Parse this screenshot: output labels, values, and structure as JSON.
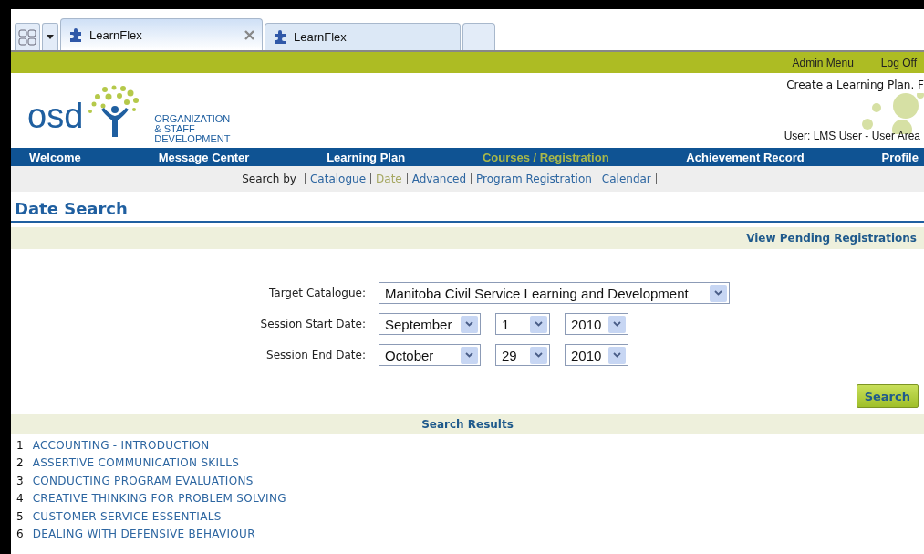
{
  "browser_tabs": [
    {
      "title": "LearnFlex",
      "selected": true
    },
    {
      "title": "LearnFlex",
      "selected": false
    }
  ],
  "top_links": [
    "Admin Menu",
    "Log Off"
  ],
  "logo": {
    "short": "osd",
    "line1": "ORGANIZATION",
    "line2": "& STAFF",
    "line3": "DEVELOPMENT"
  },
  "tagline": "Create a Learning Plan. F",
  "user_info": "User: LMS User - User Area",
  "nav": [
    {
      "label": "Welcome",
      "selected": false
    },
    {
      "label": "Message Center",
      "selected": false
    },
    {
      "label": "Learning Plan",
      "selected": false
    },
    {
      "label": "Courses / Registration",
      "selected": true
    },
    {
      "label": "Achievement Record",
      "selected": false
    },
    {
      "label": "Profile",
      "selected": false
    }
  ],
  "subnav": {
    "label": "Search by",
    "links": [
      {
        "label": "Catalogue",
        "selected": false
      },
      {
        "label": "Date",
        "selected": true
      },
      {
        "label": "Advanced",
        "selected": false
      },
      {
        "label": "Program Registration",
        "selected": false
      },
      {
        "label": "Calendar",
        "selected": false
      }
    ]
  },
  "page_title": "Date Search",
  "pending_link": "View Pending Registrations",
  "form": [
    {
      "label": "Target Catalogue:",
      "selects": [
        "Manitoba Civil Service Learning and Development"
      ]
    },
    {
      "label": "Session Start Date:",
      "selects": [
        "September",
        "1",
        "2010"
      ]
    },
    {
      "label": "Session End Date:",
      "selects": [
        "October",
        "29",
        "2010"
      ]
    }
  ],
  "search_button": "Search",
  "results_title": "Search Results",
  "results": [
    {
      "number": "1",
      "title": "ACCOUNTING - INTRODUCTION"
    },
    {
      "number": "2",
      "title": "ASSERTIVE COMMUNICATION SKILLS"
    },
    {
      "number": "3",
      "title": "CONDUCTING PROGRAM EVALUATIONS"
    },
    {
      "number": "4",
      "title": "CREATIVE THINKING FOR PROBLEM SOLVING"
    },
    {
      "number": "5",
      "title": "CUSTOMER SERVICE ESSENTIALS"
    },
    {
      "number": "6",
      "title": "DEALING WITH DEFENSIVE BEHAVIOUR"
    }
  ]
}
